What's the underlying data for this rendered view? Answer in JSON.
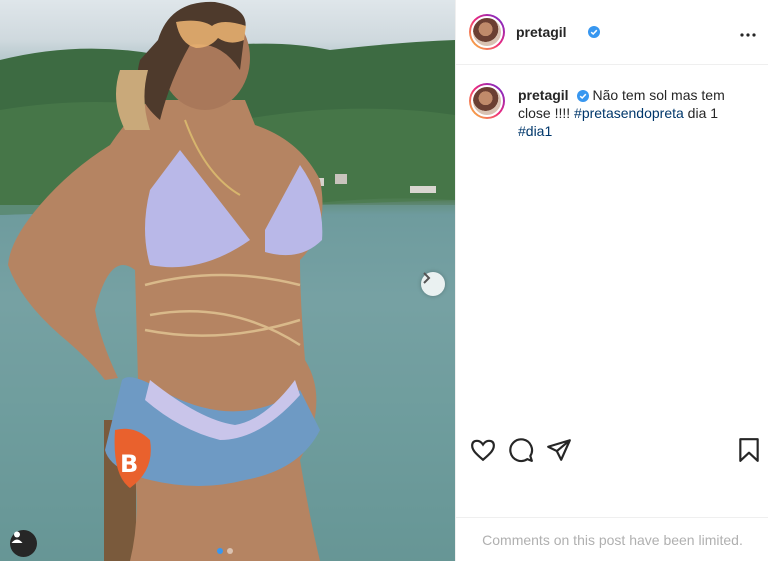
{
  "post": {
    "photo_alt_icon": "photo",
    "next_icon": "chevron-right-icon",
    "carousel_dots": 2,
    "carousel_active_index": 0
  },
  "header": {
    "username": "pretagil",
    "verified_icon": "verified-badge-icon",
    "more_icon": "more-horizontal-icon"
  },
  "caption": {
    "username": "pretagil",
    "text_before": "Não tem sol mas tem close !!!! ",
    "hashtag1": "#pretasendopreta",
    "text_middle": " dia 1 ",
    "hashtag2": "#dia1"
  },
  "actions": {
    "like_icon": "heart-icon",
    "comment_icon": "comment-icon",
    "share_icon": "send-icon",
    "save_icon": "bookmark-icon"
  },
  "footer": {
    "comments_limited": "Comments on this post have been limited."
  },
  "colors": {
    "link": "#00376b",
    "verified": "#3897f0",
    "muted": "#b0b0b0"
  }
}
